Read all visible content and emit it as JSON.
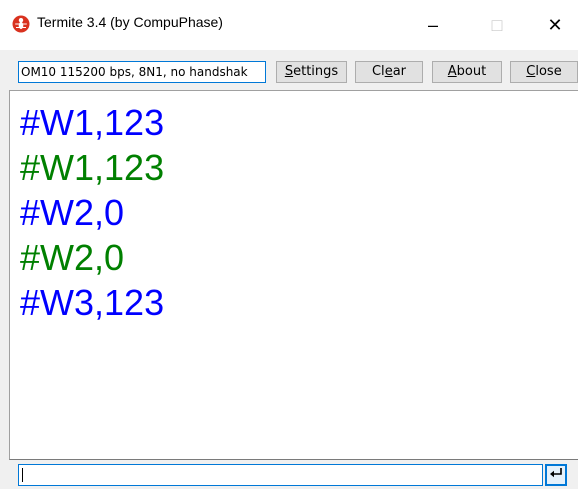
{
  "window": {
    "title": "Termite 3.4 (by CompuPhase)",
    "icon": "termite-app-icon",
    "controls": {
      "minimize": "–",
      "maximize": "□",
      "close": "✕"
    }
  },
  "toolbar": {
    "port_status": "OM10 115200 bps, 8N1, no handshak",
    "buttons": [
      {
        "label": "Settings",
        "accel": "S"
      },
      {
        "label": "Clear",
        "accel": "e"
      },
      {
        "label": "About",
        "accel": "A"
      },
      {
        "label": "Close",
        "accel": "C"
      }
    ]
  },
  "output": {
    "lines": [
      {
        "text": "#W1,123",
        "kind": "sent"
      },
      {
        "text": "#W1,123",
        "kind": "received"
      },
      {
        "text": "#W2,0",
        "kind": "sent"
      },
      {
        "text": "#W2,0",
        "kind": "received"
      },
      {
        "text": "#W3,123",
        "kind": "sent"
      }
    ],
    "colors": {
      "sent": "#0000ff",
      "received": "#008000"
    }
  },
  "input": {
    "value": "",
    "send_icon": "enter-return-icon"
  }
}
